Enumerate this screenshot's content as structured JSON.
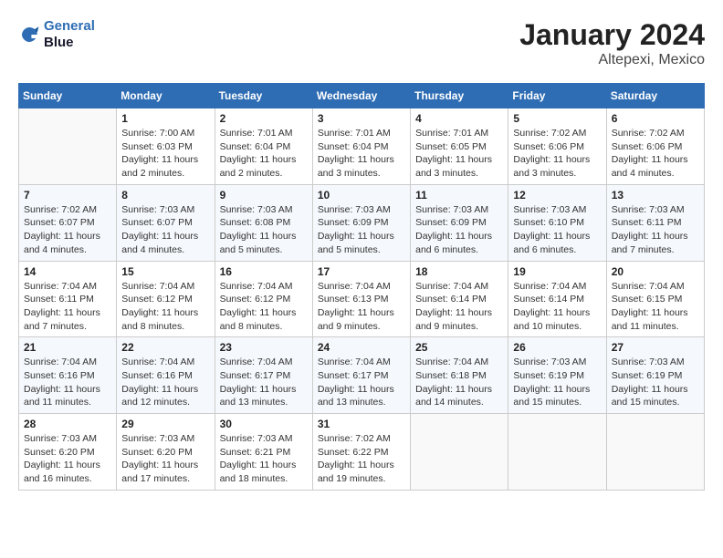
{
  "header": {
    "logo_line1": "General",
    "logo_line2": "Blue",
    "title": "January 2024",
    "subtitle": "Altepexi, Mexico"
  },
  "days_of_week": [
    "Sunday",
    "Monday",
    "Tuesday",
    "Wednesday",
    "Thursday",
    "Friday",
    "Saturday"
  ],
  "weeks": [
    [
      {
        "day": "",
        "info": ""
      },
      {
        "day": "1",
        "info": "Sunrise: 7:00 AM\nSunset: 6:03 PM\nDaylight: 11 hours\nand 2 minutes."
      },
      {
        "day": "2",
        "info": "Sunrise: 7:01 AM\nSunset: 6:04 PM\nDaylight: 11 hours\nand 2 minutes."
      },
      {
        "day": "3",
        "info": "Sunrise: 7:01 AM\nSunset: 6:04 PM\nDaylight: 11 hours\nand 3 minutes."
      },
      {
        "day": "4",
        "info": "Sunrise: 7:01 AM\nSunset: 6:05 PM\nDaylight: 11 hours\nand 3 minutes."
      },
      {
        "day": "5",
        "info": "Sunrise: 7:02 AM\nSunset: 6:06 PM\nDaylight: 11 hours\nand 3 minutes."
      },
      {
        "day": "6",
        "info": "Sunrise: 7:02 AM\nSunset: 6:06 PM\nDaylight: 11 hours\nand 4 minutes."
      }
    ],
    [
      {
        "day": "7",
        "info": "Sunrise: 7:02 AM\nSunset: 6:07 PM\nDaylight: 11 hours\nand 4 minutes."
      },
      {
        "day": "8",
        "info": "Sunrise: 7:03 AM\nSunset: 6:07 PM\nDaylight: 11 hours\nand 4 minutes."
      },
      {
        "day": "9",
        "info": "Sunrise: 7:03 AM\nSunset: 6:08 PM\nDaylight: 11 hours\nand 5 minutes."
      },
      {
        "day": "10",
        "info": "Sunrise: 7:03 AM\nSunset: 6:09 PM\nDaylight: 11 hours\nand 5 minutes."
      },
      {
        "day": "11",
        "info": "Sunrise: 7:03 AM\nSunset: 6:09 PM\nDaylight: 11 hours\nand 6 minutes."
      },
      {
        "day": "12",
        "info": "Sunrise: 7:03 AM\nSunset: 6:10 PM\nDaylight: 11 hours\nand 6 minutes."
      },
      {
        "day": "13",
        "info": "Sunrise: 7:03 AM\nSunset: 6:11 PM\nDaylight: 11 hours\nand 7 minutes."
      }
    ],
    [
      {
        "day": "14",
        "info": "Sunrise: 7:04 AM\nSunset: 6:11 PM\nDaylight: 11 hours\nand 7 minutes."
      },
      {
        "day": "15",
        "info": "Sunrise: 7:04 AM\nSunset: 6:12 PM\nDaylight: 11 hours\nand 8 minutes."
      },
      {
        "day": "16",
        "info": "Sunrise: 7:04 AM\nSunset: 6:12 PM\nDaylight: 11 hours\nand 8 minutes."
      },
      {
        "day": "17",
        "info": "Sunrise: 7:04 AM\nSunset: 6:13 PM\nDaylight: 11 hours\nand 9 minutes."
      },
      {
        "day": "18",
        "info": "Sunrise: 7:04 AM\nSunset: 6:14 PM\nDaylight: 11 hours\nand 9 minutes."
      },
      {
        "day": "19",
        "info": "Sunrise: 7:04 AM\nSunset: 6:14 PM\nDaylight: 11 hours\nand 10 minutes."
      },
      {
        "day": "20",
        "info": "Sunrise: 7:04 AM\nSunset: 6:15 PM\nDaylight: 11 hours\nand 11 minutes."
      }
    ],
    [
      {
        "day": "21",
        "info": "Sunrise: 7:04 AM\nSunset: 6:16 PM\nDaylight: 11 hours\nand 11 minutes."
      },
      {
        "day": "22",
        "info": "Sunrise: 7:04 AM\nSunset: 6:16 PM\nDaylight: 11 hours\nand 12 minutes."
      },
      {
        "day": "23",
        "info": "Sunrise: 7:04 AM\nSunset: 6:17 PM\nDaylight: 11 hours\nand 13 minutes."
      },
      {
        "day": "24",
        "info": "Sunrise: 7:04 AM\nSunset: 6:17 PM\nDaylight: 11 hours\nand 13 minutes."
      },
      {
        "day": "25",
        "info": "Sunrise: 7:04 AM\nSunset: 6:18 PM\nDaylight: 11 hours\nand 14 minutes."
      },
      {
        "day": "26",
        "info": "Sunrise: 7:03 AM\nSunset: 6:19 PM\nDaylight: 11 hours\nand 15 minutes."
      },
      {
        "day": "27",
        "info": "Sunrise: 7:03 AM\nSunset: 6:19 PM\nDaylight: 11 hours\nand 15 minutes."
      }
    ],
    [
      {
        "day": "28",
        "info": "Sunrise: 7:03 AM\nSunset: 6:20 PM\nDaylight: 11 hours\nand 16 minutes."
      },
      {
        "day": "29",
        "info": "Sunrise: 7:03 AM\nSunset: 6:20 PM\nDaylight: 11 hours\nand 17 minutes."
      },
      {
        "day": "30",
        "info": "Sunrise: 7:03 AM\nSunset: 6:21 PM\nDaylight: 11 hours\nand 18 minutes."
      },
      {
        "day": "31",
        "info": "Sunrise: 7:02 AM\nSunset: 6:22 PM\nDaylight: 11 hours\nand 19 minutes."
      },
      {
        "day": "",
        "info": ""
      },
      {
        "day": "",
        "info": ""
      },
      {
        "day": "",
        "info": ""
      }
    ]
  ]
}
